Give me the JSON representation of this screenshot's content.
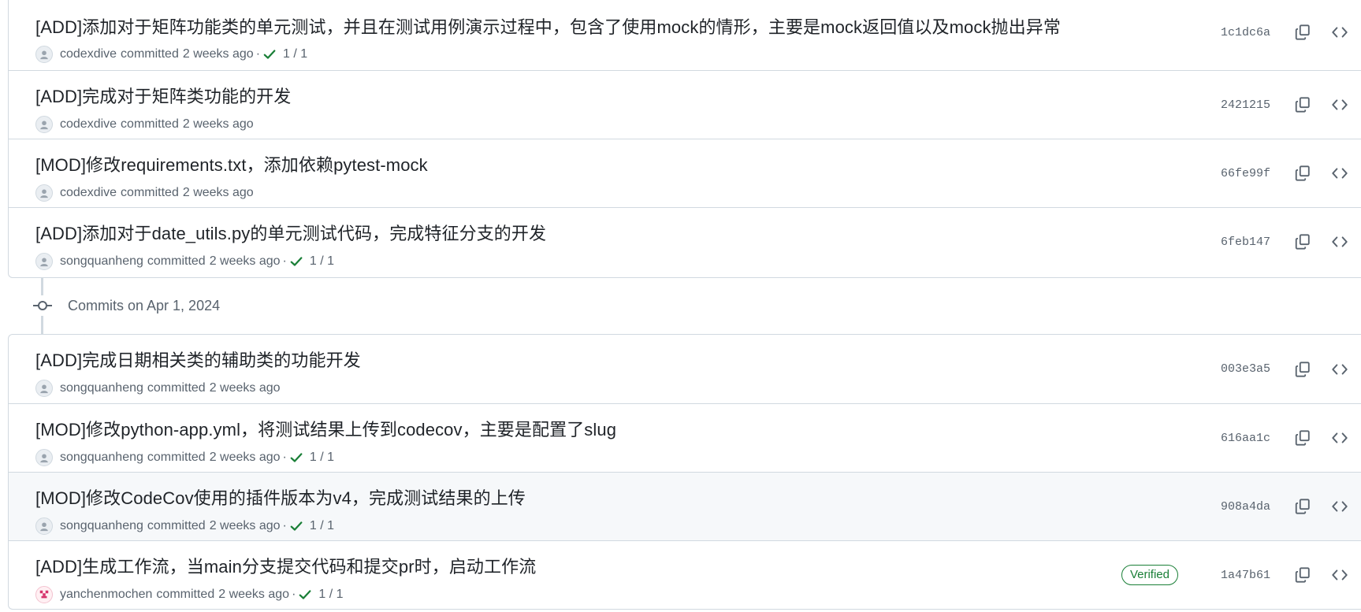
{
  "colors": {
    "border": "#d1d9e0",
    "muted_text": "#59636e",
    "success_green": "#1a7f37",
    "hover_row": "#f6f8fa"
  },
  "groups": [
    {
      "heading": "",
      "commits": [
        {
          "title": "[ADD]添加对于矩阵功能类的单元测试，并且在测试用例演示过程中，包含了使用mock的情形，主要是mock返回值以及mock抛出异常",
          "author": "codexdive",
          "committed": "committed",
          "when": "2 weeks ago",
          "has_ci": true,
          "ci_dot": "·",
          "ci_count": "1 / 1",
          "verified": false,
          "verified_label": "",
          "sha": "1c1dc6a",
          "avatar": "default-avatar-icon"
        },
        {
          "title": "[ADD]完成对于矩阵类功能的开发",
          "author": "codexdive",
          "committed": "committed",
          "when": "2 weeks ago",
          "has_ci": false,
          "ci_dot": "",
          "ci_count": "",
          "verified": false,
          "verified_label": "",
          "sha": "2421215",
          "avatar": "default-avatar-icon"
        },
        {
          "title": "[MOD]修改requirements.txt，添加依赖pytest-mock",
          "author": "codexdive",
          "committed": "committed",
          "when": "2 weeks ago",
          "has_ci": false,
          "ci_dot": "",
          "ci_count": "",
          "verified": false,
          "verified_label": "",
          "sha": "66fe99f",
          "avatar": "default-avatar-icon"
        },
        {
          "title": "[ADD]添加对于date_utils.py的单元测试代码，完成特征分支的开发",
          "author": "songquanheng",
          "committed": "committed",
          "when": "2 weeks ago",
          "has_ci": true,
          "ci_dot": "·",
          "ci_count": "1 / 1",
          "verified": false,
          "verified_label": "",
          "sha": "6feb147",
          "avatar": "default-avatar-icon"
        }
      ]
    },
    {
      "heading": "Commits on Apr 1, 2024",
      "commits": [
        {
          "title": "[ADD]完成日期相关类的辅助类的功能开发",
          "author": "songquanheng",
          "committed": "committed",
          "when": "2 weeks ago",
          "has_ci": false,
          "ci_dot": "",
          "ci_count": "",
          "verified": false,
          "verified_label": "",
          "sha": "003e3a5",
          "avatar": "default-avatar-icon"
        },
        {
          "title": "[MOD]修改python-app.yml，将测试结果上传到codecov，主要是配置了slug",
          "author": "songquanheng",
          "committed": "committed",
          "when": "2 weeks ago",
          "has_ci": true,
          "ci_dot": "·",
          "ci_count": "1 / 1",
          "verified": false,
          "verified_label": "",
          "sha": "616aa1c",
          "avatar": "default-avatar-icon"
        },
        {
          "title": "[MOD]修改CodeCov使用的插件版本为v4，完成测试结果的上传",
          "author": "songquanheng",
          "committed": "committed",
          "when": "2 weeks ago",
          "has_ci": true,
          "ci_dot": "·",
          "ci_count": "1 / 1",
          "verified": false,
          "verified_label": "",
          "sha": "908a4da",
          "avatar": "default-avatar-icon",
          "hovered": true
        },
        {
          "title": "[ADD]生成工作流，当main分支提交代码和提交pr时，启动工作流",
          "author": "yanchenmochen",
          "committed": "committed",
          "when": "2 weeks ago",
          "has_ci": true,
          "ci_dot": "·",
          "ci_count": "1 / 1",
          "verified": true,
          "verified_label": "Verified",
          "sha": "1a47b61",
          "avatar": "pink-identicon-avatar"
        }
      ]
    }
  ]
}
